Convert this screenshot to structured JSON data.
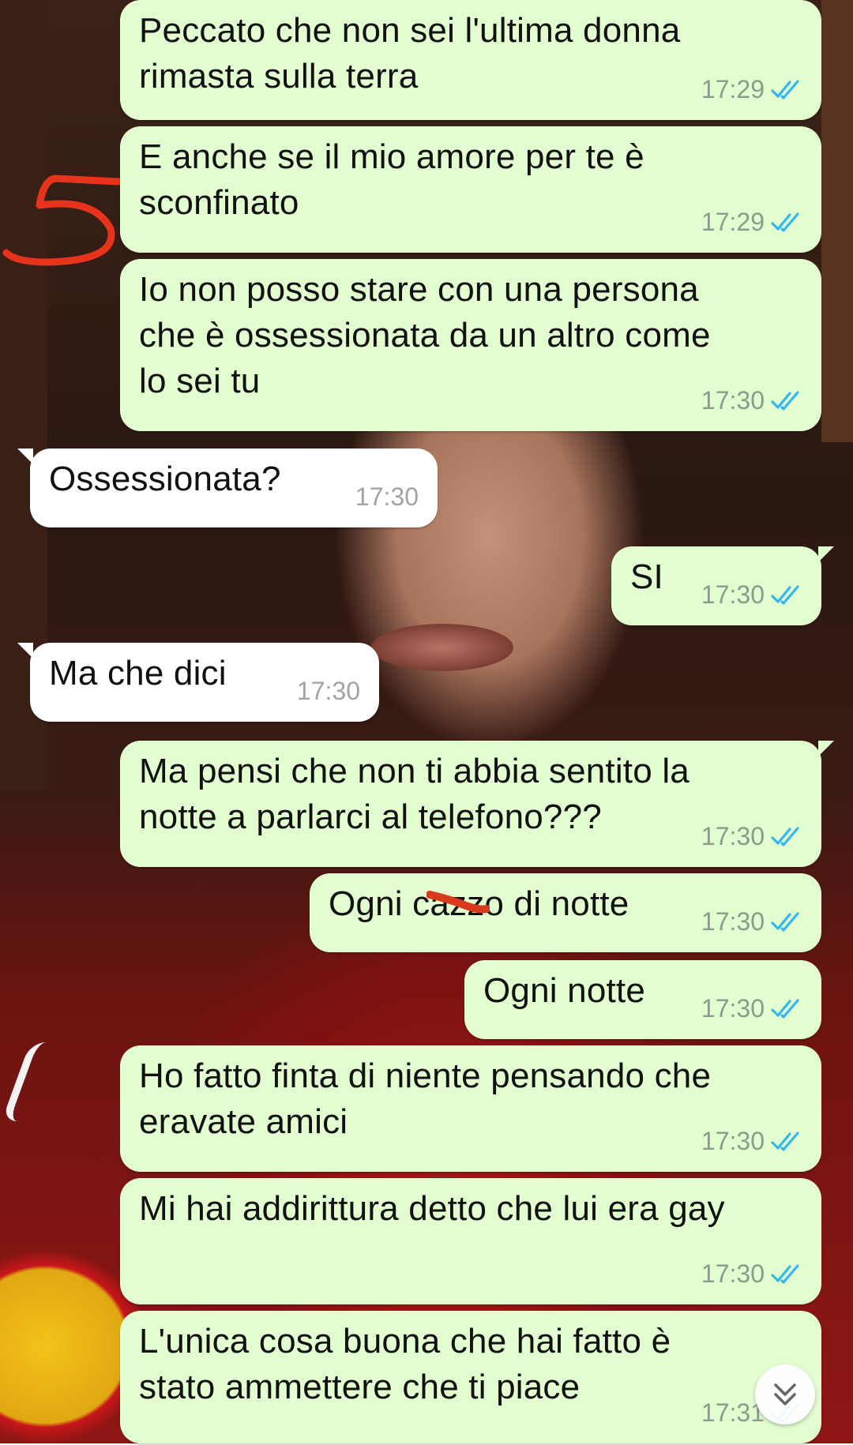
{
  "theme": {
    "outgoing_bubble": "#e2fdd0",
    "incoming_bubble": "#ffffff",
    "read_ticks": "#34b7f1",
    "annotation": "#e8331c"
  },
  "annotation": {
    "label": "5"
  },
  "messages": [
    {
      "direction": "out",
      "text": "Peccato che non sei l'ultima donna\nrimasta sulla terra",
      "time": "17:29",
      "status": "read"
    },
    {
      "direction": "out",
      "text": "E anche se il mio amore per te è\nsconfinato",
      "time": "17:29",
      "status": "read"
    },
    {
      "direction": "out",
      "text": "Io non posso stare con una persona\nche è ossessionata da un altro come\nlo sei tu",
      "time": "17:30",
      "status": "read"
    },
    {
      "direction": "in",
      "text": "Ossessionata?",
      "time": "17:30"
    },
    {
      "direction": "out",
      "text": "SI",
      "time": "17:30",
      "status": "read"
    },
    {
      "direction": "in",
      "text": "Ma che dici",
      "time": "17:30"
    },
    {
      "direction": "out",
      "text": "Ma pensi che non ti abbia sentito la\nnotte a parlarci al telefono???",
      "time": "17:30",
      "status": "read"
    },
    {
      "direction": "out",
      "text": "Ogni cazzo di notte",
      "time": "17:30",
      "status": "read"
    },
    {
      "direction": "out",
      "text": "Ogni notte",
      "time": "17:30",
      "status": "read"
    },
    {
      "direction": "out",
      "text": "Ho fatto finta di niente pensando che\neravate amici",
      "time": "17:30",
      "status": "read"
    },
    {
      "direction": "out",
      "text": "Mi hai addirittura detto che lui era gay",
      "time": "17:30",
      "status": "read"
    },
    {
      "direction": "out",
      "text": "L'unica cosa buona che hai fatto è\nstato ammettere che ti piace",
      "time": "17:31",
      "status": "read"
    }
  ],
  "scroll_button_icon": "double-chevron-down-icon"
}
